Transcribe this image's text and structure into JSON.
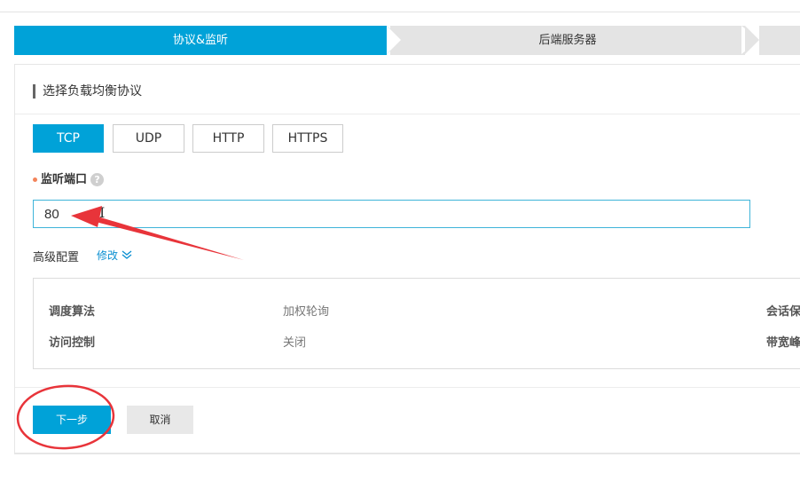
{
  "steps": [
    {
      "label": "协议&监听"
    },
    {
      "label": "后端服务器"
    },
    {
      "label": ""
    }
  ],
  "section": {
    "title": "选择负载均衡协议"
  },
  "protocols": [
    {
      "label": "TCP",
      "active": true
    },
    {
      "label": "UDP",
      "active": false
    },
    {
      "label": "HTTP",
      "active": false
    },
    {
      "label": "HTTPS",
      "active": false
    }
  ],
  "port_field": {
    "label": "监听端口",
    "help": "?",
    "value": "80"
  },
  "advanced": {
    "label": "高级配置",
    "edit_label": "修改",
    "rows": [
      {
        "key": "调度算法",
        "value": "加权轮询",
        "key2": "会话保"
      },
      {
        "key": "访问控制",
        "value": "关闭",
        "key2": "带宽峰"
      }
    ]
  },
  "buttons": {
    "next": "下一步",
    "cancel": "取消"
  },
  "colors": {
    "accent": "#00a2d8",
    "annotation": "#e8343a",
    "link": "#0a8fd1"
  }
}
